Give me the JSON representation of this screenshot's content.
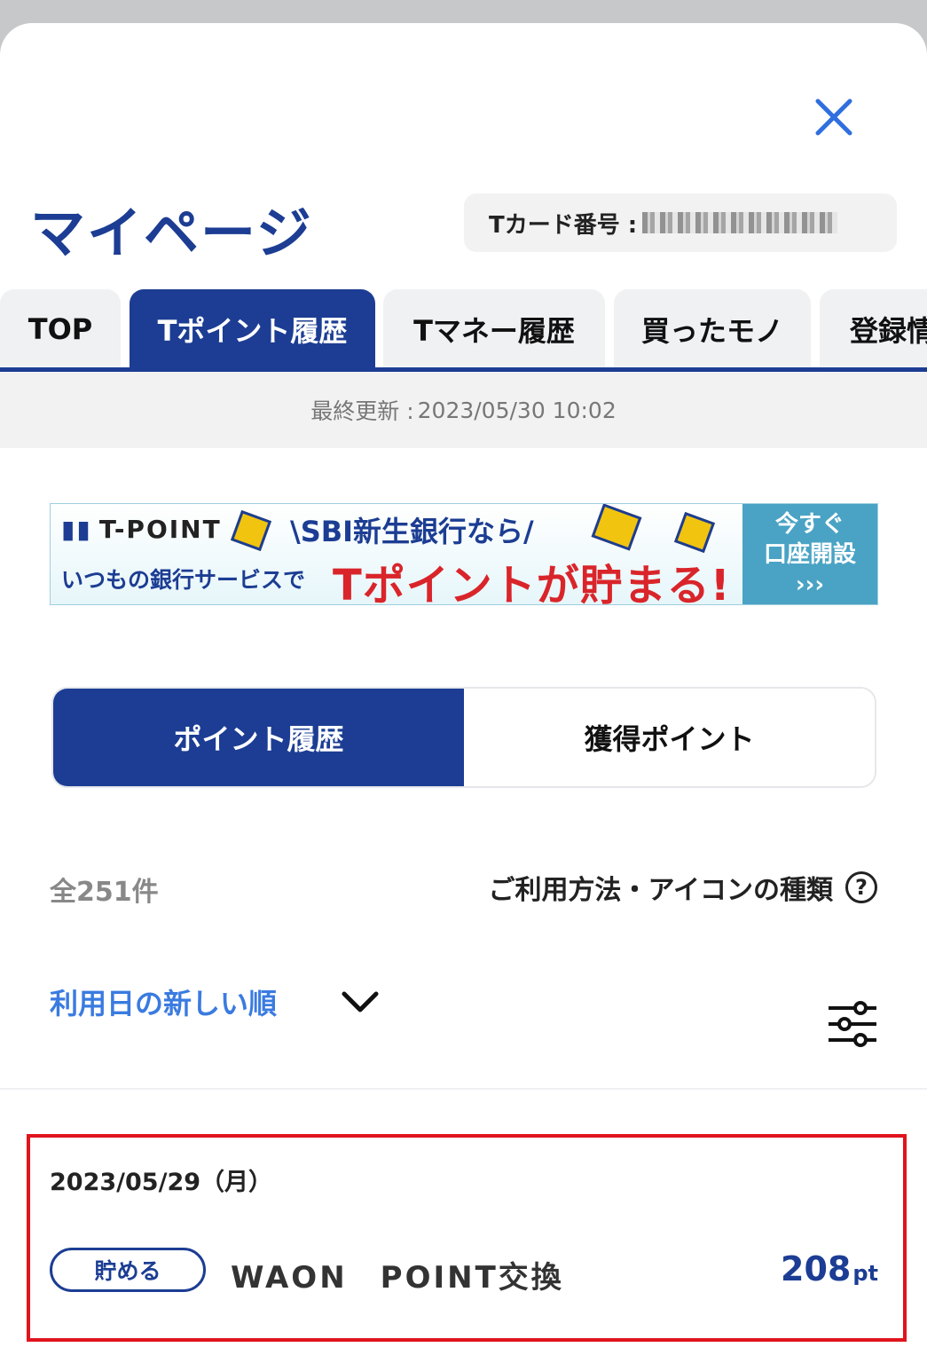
{
  "header": {
    "close_icon": "close-icon",
    "title": "マイページ",
    "card_label": "Tカード番号 :"
  },
  "tabs": [
    {
      "label": "TOP",
      "active": false
    },
    {
      "label": "Tポイント履歴",
      "active": true
    },
    {
      "label": "Tマネー履歴",
      "active": false
    },
    {
      "label": "買ったモノ",
      "active": false
    },
    {
      "label": "登録情",
      "active": false
    }
  ],
  "last_updated": {
    "label": "最終更新 :",
    "value": "2023/05/30 10:02"
  },
  "banner": {
    "logo": "T-POINT",
    "headline": "\\SBI新生銀行なら/",
    "subline": "いつもの銀行サービスで",
    "main": "Tポイントが貯まる!",
    "cta_line1": "今すぐ",
    "cta_line2": "口座開設",
    "cta_arrows": "›››"
  },
  "segment": {
    "options": [
      "ポイント履歴",
      "獲得ポイント"
    ],
    "selected": "ポイント履歴"
  },
  "summary": {
    "count": "全251件",
    "help_label": "ご利用方法・アイコンの種類",
    "help_icon": "question-circle-icon"
  },
  "sort": {
    "label": "利用日の新しい順",
    "chevron_icon": "chevron-down-icon",
    "filter_icon": "filter-sliders-icon"
  },
  "history": [
    {
      "date": "2023/05/29（月）",
      "badge": "貯める",
      "description": "WAON　POINT交換",
      "points": "208",
      "unit": "pt"
    }
  ],
  "colors": {
    "primary": "#1c3d93",
    "link": "#3a7be0",
    "highlight_border": "#e0141d",
    "banner_red": "#d9252a"
  }
}
